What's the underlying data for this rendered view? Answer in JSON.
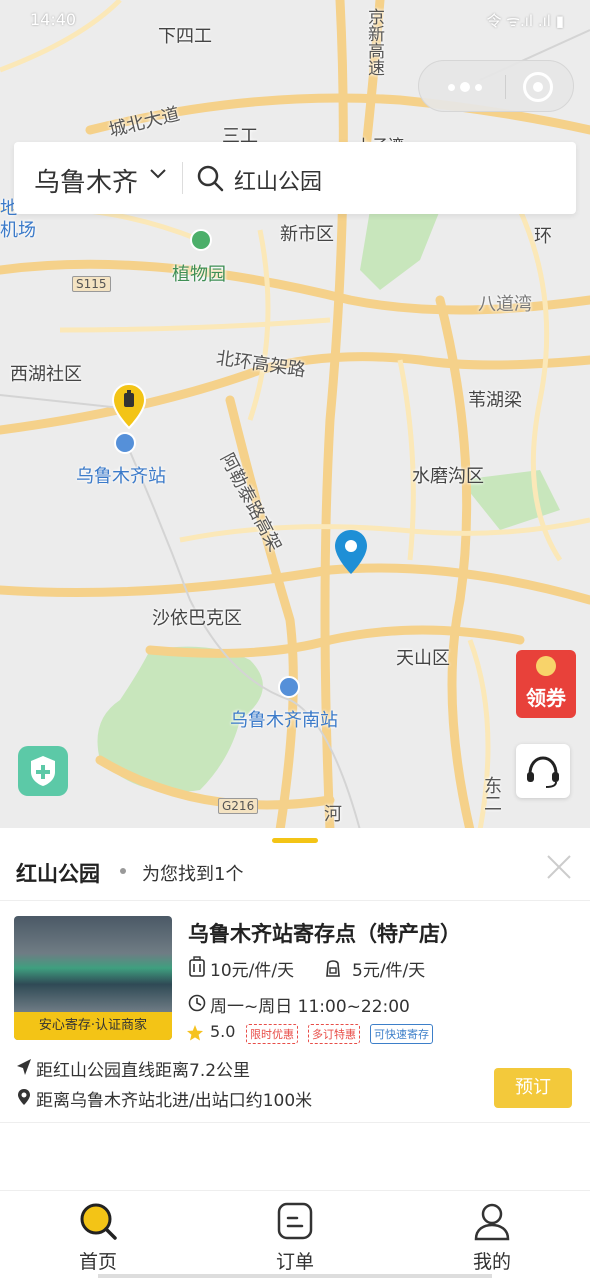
{
  "status_bar": {
    "time": "14:40",
    "icons": "令 ᯤ.ıl .ıl ▮"
  },
  "search": {
    "city": "乌鲁木齐",
    "query": "红山公园"
  },
  "map": {
    "labels": {
      "xiasigong": "下四工",
      "chengbei": "城北大道",
      "sangong": "三工",
      "jingxin": "京新高速",
      "shangzi": "上子湾",
      "di": "地",
      "jichang": "机场",
      "xinshi": "新市区",
      "huan": "环",
      "zhiwuyuan": "植物园",
      "badaowan": "八道湾",
      "s115": "S115",
      "xihu": "西湖社区",
      "beihuan": "北环高架路",
      "weihuliang": "苇湖梁",
      "urumqi_station": "乌鲁木齐站",
      "alerta": "阿勒泰路高架",
      "shuimogou": "水磨沟区",
      "shayibake": "沙依巴克区",
      "tianshan": "天山区",
      "south_station": "乌鲁木齐南站",
      "g216": "G216",
      "he": "河",
      "dong": "东二",
      "coupon": "领券"
    }
  },
  "sheet": {
    "title": "红山公园",
    "count_text": "为您找到1个",
    "store": {
      "name": "乌鲁木齐站寄存点（特产店）",
      "badge": "安心寄存·认证商家",
      "price_small": "10元/件/天",
      "price_bag": "5元/件/天",
      "hours": "周一~周日 11:00~22:00",
      "rating": "5.0",
      "tags": [
        "限时优惠",
        "多订特惠",
        "可快速寄存"
      ],
      "distance_line": "距红山公园直线距离7.2公里",
      "location_line": "距离乌鲁木齐站北进/出站口约100米",
      "book_label": "预订"
    }
  },
  "tabs": [
    {
      "label": "首页"
    },
    {
      "label": "订单"
    },
    {
      "label": "我的"
    }
  ],
  "colors": {
    "accent": "#f3c416",
    "map_road": "#f7d99a",
    "map_bg": "#ececec"
  }
}
